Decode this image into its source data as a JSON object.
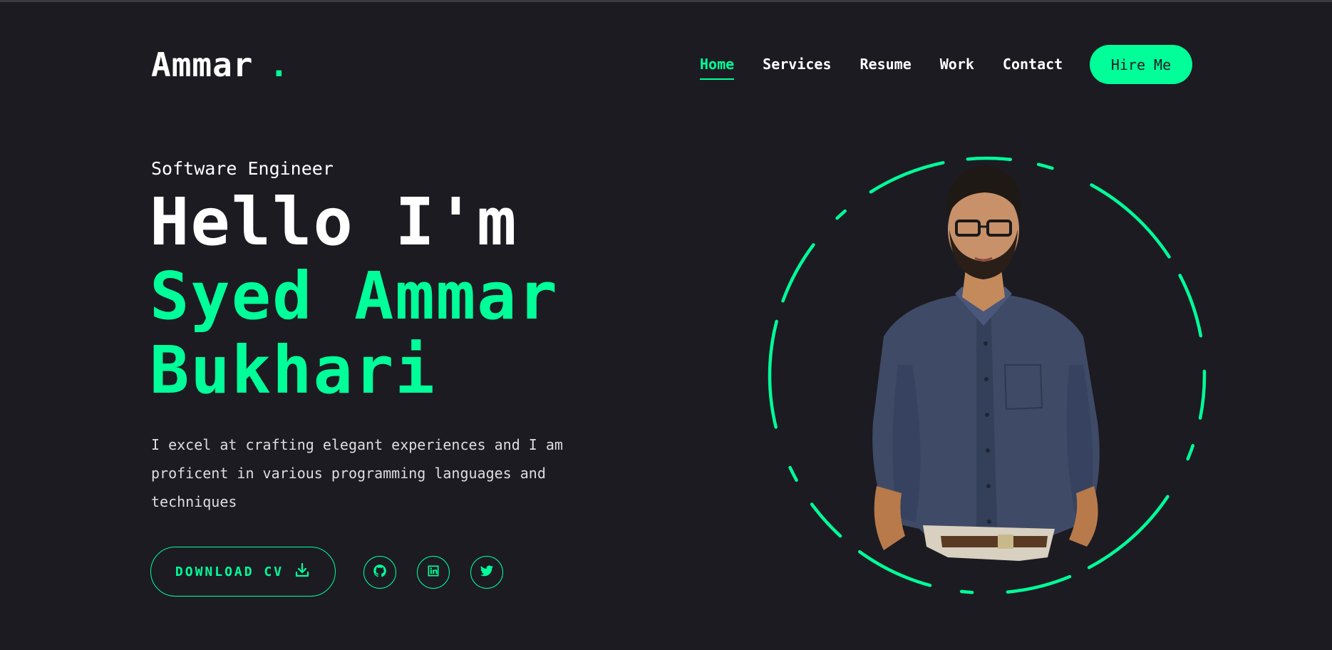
{
  "header": {
    "logo_text": "Ammar",
    "logo_dot": ".",
    "nav": [
      {
        "label": "Home",
        "active": true
      },
      {
        "label": "Services",
        "active": false
      },
      {
        "label": "Resume",
        "active": false
      },
      {
        "label": "Work",
        "active": false
      },
      {
        "label": "Contact",
        "active": false
      }
    ],
    "hire_label": "Hire Me"
  },
  "hero": {
    "role": "Software Engineer",
    "greeting": "Hello I'm",
    "name_line1": "Syed Ammar",
    "name_line2": "Bukhari",
    "description": "I excel at crafting elegant experiences and I am proficent in various programming languages and techniques"
  },
  "actions": {
    "download_label": "DOWNLOAD CV",
    "download_icon": "download-icon",
    "socials": [
      {
        "name": "github",
        "icon": "github-icon"
      },
      {
        "name": "linkedin",
        "icon": "linkedin-icon"
      },
      {
        "name": "twitter",
        "icon": "twitter-icon"
      }
    ]
  },
  "colors": {
    "background": "#1c1b22",
    "accent": "#00ff99",
    "text": "#ffffff"
  }
}
